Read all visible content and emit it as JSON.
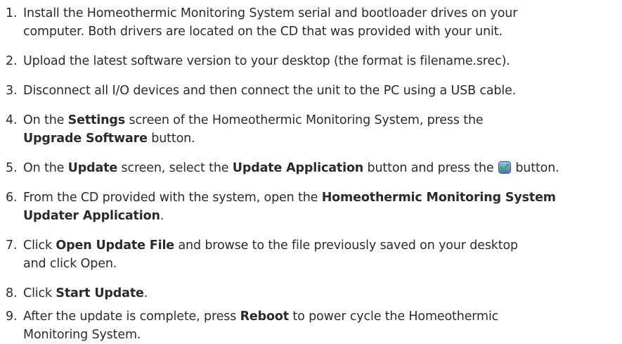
{
  "steps": [
    {
      "num": "1.",
      "line1": "Install the Homeothermic Monitoring System serial and bootloader drives on your",
      "line2": "computer. Both drivers are located on the CD that was provided with your unit."
    },
    {
      "num": "2.",
      "line1": "Upload the latest software version to your desktop (the format is filename.srec)."
    },
    {
      "num": "3.",
      "line1": "Disconnect all I/O devices and then connect the unit to the PC using a USB cable."
    },
    {
      "num": "4.",
      "a": "On the ",
      "b": "Settings",
      "c": " screen of the Homeothermic Monitoring System, press the",
      "d": "Upgrade Software",
      "e": " button."
    },
    {
      "num": "5.",
      "a": "On the ",
      "b": "Update",
      "c": " screen, select the ",
      "d": "Update Application",
      "e": " button and press the ",
      "f": " button.",
      "icon": "checkmark-button-icon"
    },
    {
      "num": "6.",
      "a": "From the CD provided with the system, open the ",
      "b": "Homeothermic Monitoring System",
      "c": "Updater Application",
      "d": "."
    },
    {
      "num": "7.",
      "a": "Click ",
      "b": "Open Update File",
      "c": " and browse to the file previously saved on your desktop",
      "d": "and click Open."
    },
    {
      "num": "8.",
      "a": "Click ",
      "b": "Start Update",
      "c": "."
    },
    {
      "num": "9.",
      "a": "After the update is complete, press ",
      "b": "Reboot",
      "c": " to power cycle the Homeothermic",
      "d": "Monitoring System."
    }
  ],
  "colors": {
    "text": "#2b2b2b",
    "check_bg": "#5b8fd0",
    "check_mark": "#3fae2a"
  }
}
